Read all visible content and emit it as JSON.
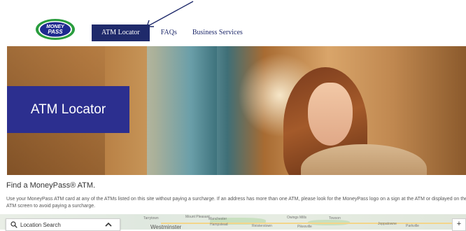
{
  "header": {
    "logo": {
      "line1": "MONEY",
      "line2": "PASS"
    },
    "nav": [
      {
        "label": "ATM Locator",
        "active": true
      },
      {
        "label": "FAQs",
        "active": false
      },
      {
        "label": "Business Services",
        "active": false
      }
    ]
  },
  "hero": {
    "title": "ATM Locator"
  },
  "main": {
    "subtitle": "Find a MoneyPass® ATM.",
    "description": "Use your MoneyPass ATM card at any of the ATMs listed on this site without paying a surcharge. If an address has more than one ATM, please look for the MoneyPass logo on a sign at the ATM or displayed on the ATM screen to avoid paying a surcharge."
  },
  "map": {
    "search_label": "Location Search",
    "zoom_in_label": "+",
    "place_labels": [
      "Tarrytown",
      "Mount Pleasant",
      "Manchester",
      "Westminster",
      "Hampstead",
      "Reisterstown",
      "Owings Mills",
      "Pikesville",
      "Towson",
      "Joppatowne",
      "Parkville"
    ]
  },
  "colors": {
    "brand_navy": "#1f2a6b",
    "hero_box": "#2c2f8f",
    "logo_green": "#2a9d3e"
  }
}
